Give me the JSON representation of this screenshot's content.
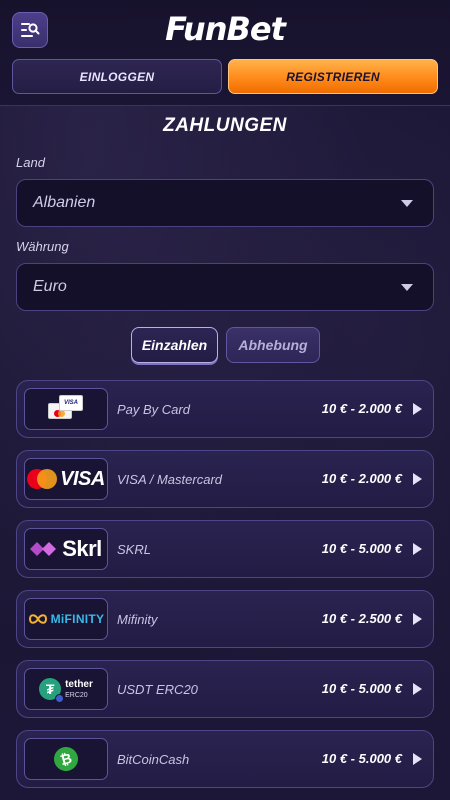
{
  "header": {
    "brand": "FunBet",
    "login_label": "EINLOGGEN",
    "register_label": "REGISTRIEREN",
    "menu_icon": "menu-search-icon"
  },
  "page": {
    "title": "ZAHLUNGEN",
    "country_label": "Land",
    "country_value": "Albanien",
    "currency_label": "Währung",
    "currency_value": "Euro"
  },
  "tabs": [
    {
      "label": "Einzahlen",
      "active": true
    },
    {
      "label": "Abhebung",
      "active": false
    }
  ],
  "methods": [
    {
      "name": "Pay By Card",
      "range": "10 € - 2.000 €",
      "logo": "cards-logo",
      "logo_text": "VISA"
    },
    {
      "name": "VISA / Mastercard",
      "range": "10 € - 2.000 €",
      "logo": "visa-mastercard-logo",
      "logo_text": "VISA"
    },
    {
      "name": "SKRL",
      "range": "10 € - 5.000 €",
      "logo": "skrill-logo",
      "logo_text": "Skrl"
    },
    {
      "name": "Mifinity",
      "range": "10 € - 2.500 €",
      "logo": "mifinity-logo",
      "logo_text": "MiFINITY"
    },
    {
      "name": "USDT ERC20",
      "range": "10 € - 5.000 €",
      "logo": "tether-logo",
      "logo_text": "tether",
      "logo_sub": "ERC20"
    },
    {
      "name": "BitCoinCash",
      "range": "10 € - 5.000 €",
      "logo": "bitcoincash-logo",
      "logo_text": "₿"
    }
  ],
  "colors": {
    "accent_orange": "#ff8a1a",
    "background": "#1b1633",
    "panel": "#2a2350"
  }
}
